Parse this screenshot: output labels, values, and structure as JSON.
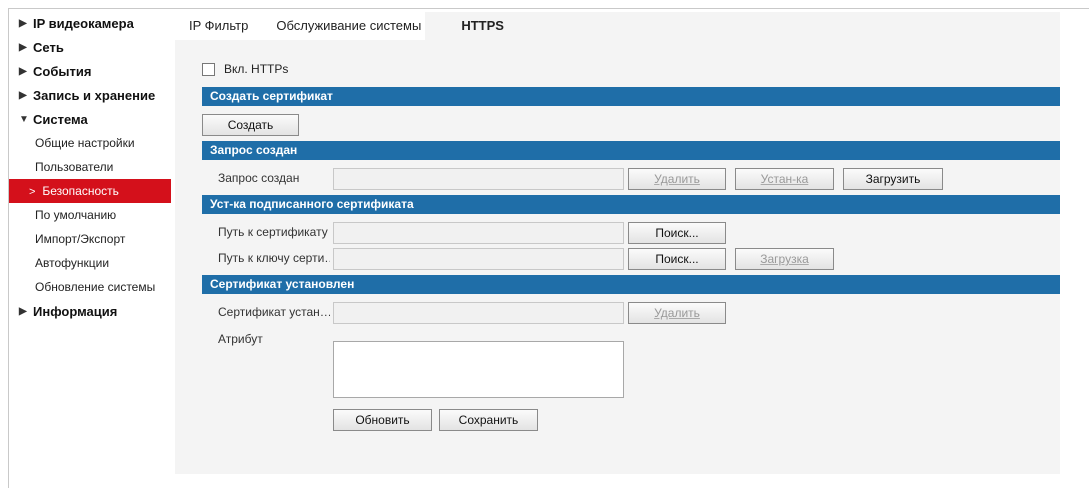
{
  "sidebar": {
    "items": [
      {
        "label": "IP видеокамера",
        "expanded": false
      },
      {
        "label": "Сеть",
        "expanded": false
      },
      {
        "label": "События",
        "expanded": false
      },
      {
        "label": "Запись и хранение",
        "expanded": false
      },
      {
        "label": "Система",
        "expanded": true
      },
      {
        "label": "Информация",
        "expanded": false
      }
    ],
    "system_subitems": [
      {
        "label": "Общие настройки"
      },
      {
        "label": "Пользователи"
      },
      {
        "label": "Безопасность",
        "active": true
      },
      {
        "label": "По умолчанию"
      },
      {
        "label": "Импорт/Экспорт"
      },
      {
        "label": "Автофункции"
      },
      {
        "label": "Обновление системы"
      }
    ],
    "collapsed_arrow": "▶",
    "expanded_arrow": "▼",
    "active_chevron": ">"
  },
  "tabs": [
    {
      "label": "IP Фильтр"
    },
    {
      "label": "Обслуживание системы"
    },
    {
      "label": "HTTPS",
      "active": true
    }
  ],
  "https": {
    "enable_label": "Вкл. HTTPs",
    "enabled": false
  },
  "create_cert": {
    "header": "Создать сертификат",
    "create_button": "Создать"
  },
  "request_created": {
    "header": "Запрос создан",
    "field_label": "Запрос создан",
    "field_value": "",
    "delete_button": "Удалить",
    "install_button": "Устан-ка",
    "download_button": "Загрузить"
  },
  "signed_cert": {
    "header": "Уст-ка подписанного сертификата",
    "cert_path_label": "Путь к сертификату",
    "cert_path_value": "",
    "key_path_label": "Путь к ключу серти…",
    "key_path_value": "",
    "browse_button": "Поиск...",
    "upload_button": "Загрузка"
  },
  "installed_cert": {
    "header": "Сертификат установлен",
    "installed_label": "Сертификат устан…",
    "installed_value": "",
    "delete_button": "Удалить",
    "attribute_label": "Атрибут",
    "attribute_value": ""
  },
  "footer": {
    "refresh_button": "Обновить",
    "save_button": "Сохранить"
  },
  "colors": {
    "accent_blue": "#1f6ea8",
    "active_red": "#d4101b",
    "panel_bg": "#f4f4f4"
  }
}
